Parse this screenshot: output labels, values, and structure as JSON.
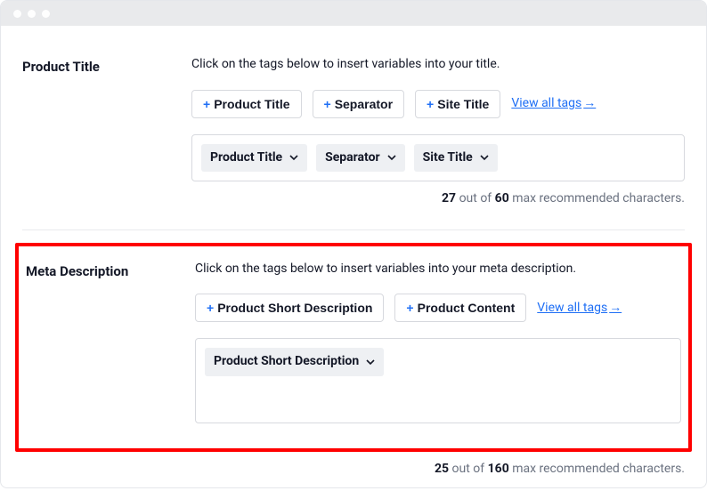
{
  "window": {
    "dots": 3
  },
  "title_section": {
    "label": "Product Title",
    "helper": "Click on the tags below to insert variables into your title.",
    "tags": [
      "Product Title",
      "Separator",
      "Site Title"
    ],
    "view_all": "View all tags",
    "arrow": "→",
    "chips": [
      "Product Title",
      "Separator",
      "Site Title"
    ],
    "count_current": "27",
    "count_max": "60",
    "count_prefix": " out of ",
    "count_suffix": " max recommended characters."
  },
  "meta_section": {
    "label": "Meta Description",
    "helper": "Click on the tags below to insert variables into your meta description.",
    "tags": [
      "Product Short Description",
      "Product Content"
    ],
    "view_all": "View all tags",
    "arrow": "→",
    "chips": [
      "Product Short Description"
    ],
    "count_current": "25",
    "count_max": "160",
    "count_prefix": " out of ",
    "count_suffix": " max recommended characters."
  }
}
